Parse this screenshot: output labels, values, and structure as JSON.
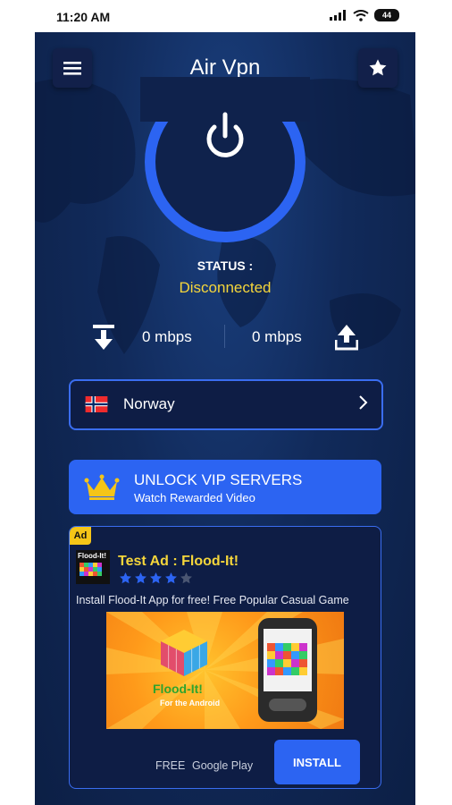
{
  "statusbar": {
    "time": "11:20 AM",
    "battery": "44"
  },
  "header": {
    "title": "Air Vpn"
  },
  "connection": {
    "status_label": "STATUS :",
    "status_value": "Disconnected"
  },
  "speed": {
    "download": "0 mbps",
    "upload": "0 mbps"
  },
  "server": {
    "country": "Norway"
  },
  "vip": {
    "title": "UNLOCK VIP SERVERS",
    "subtitle": "Watch Rewarded Video"
  },
  "ad": {
    "badge": "Ad",
    "logo_text": "Flood-It!",
    "title": "Test Ad : Flood-It!",
    "rating": 4,
    "rating_max": 5,
    "description": "Install Flood-It App for free! Free Popular Casual Game",
    "image_brand": "Flood-It!",
    "image_sub": "For the Android",
    "price": "FREE",
    "store": "Google Play",
    "install_label": "INSTALL"
  },
  "colors": {
    "accent": "#2c64f2",
    "status": "#f5d63b",
    "background": "#0c1c3f"
  }
}
